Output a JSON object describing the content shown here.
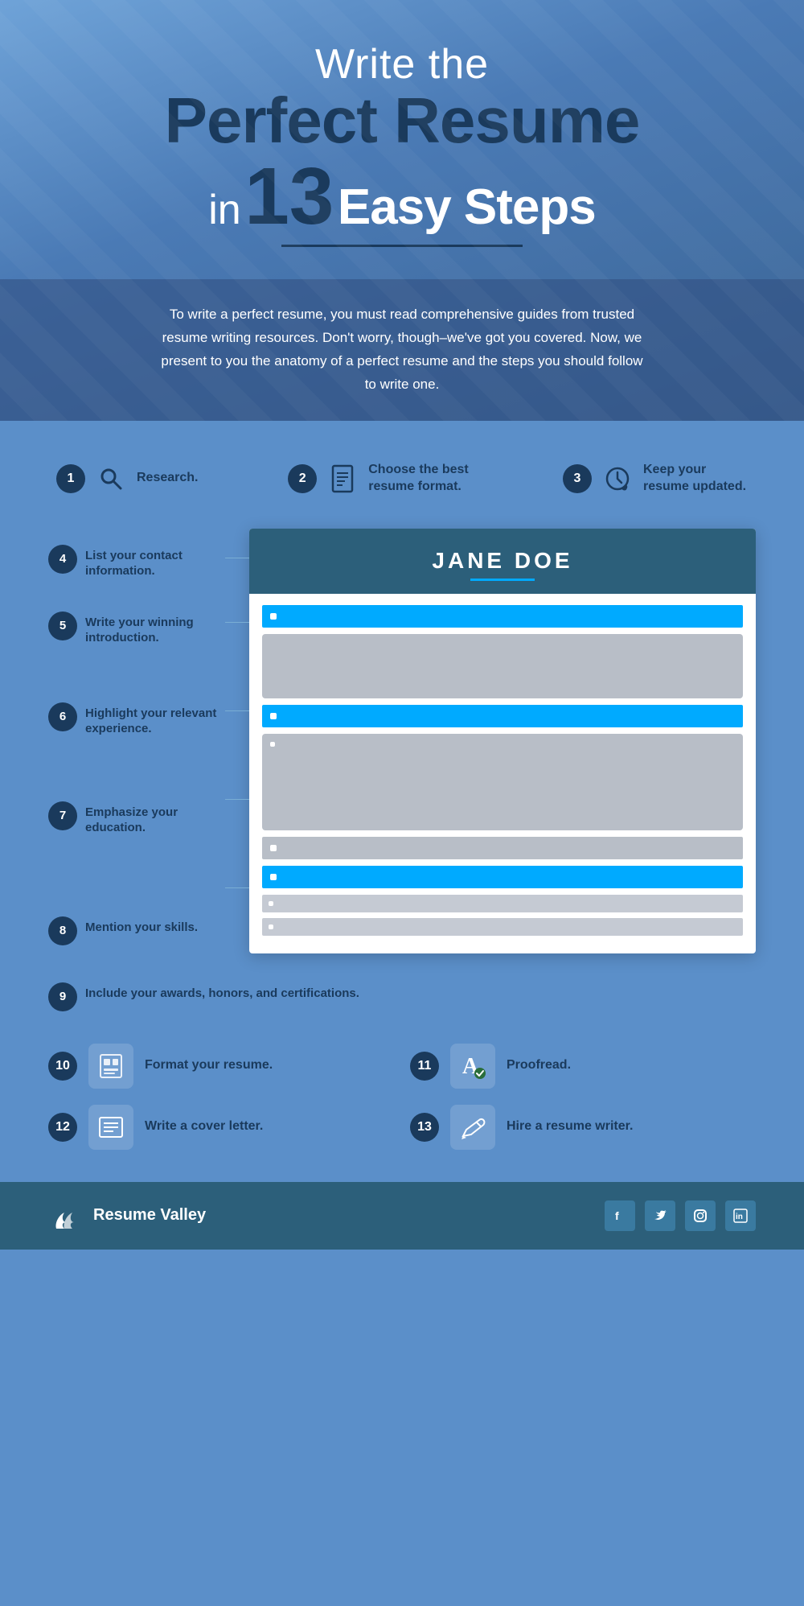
{
  "header": {
    "line1": "Write the",
    "line2": "Perfect Resume",
    "line3_in": "in",
    "line3_num": "13",
    "line3_rest": "Easy Steps",
    "subtitle": "To write a perfect resume, you must read comprehensive guides from trusted resume writing resources. Don't worry, though–we've got you covered. Now, we present to you the anatomy of a perfect resume and the steps you should follow to write one."
  },
  "steps": {
    "step1": {
      "number": "1",
      "label": "Research."
    },
    "step2": {
      "number": "2",
      "label": "Choose the best resume format."
    },
    "step3": {
      "number": "3",
      "label": "Keep your resume updated."
    },
    "step4": {
      "number": "4",
      "label": "List your contact information."
    },
    "step5": {
      "number": "5",
      "label": "Write your winning introduction."
    },
    "step6": {
      "number": "6",
      "label": "Highlight your relevant experience."
    },
    "step7": {
      "number": "7",
      "label": "Emphasize your education."
    },
    "step8": {
      "number": "8",
      "label": "Mention your skills."
    },
    "step9": {
      "number": "9",
      "label": "Include your awards, honors, and certifications."
    },
    "step10": {
      "number": "10",
      "label": "Format your resume."
    },
    "step11": {
      "number": "11",
      "label": "Proofread."
    },
    "step12": {
      "number": "12",
      "label": "Write a cover letter."
    },
    "step13": {
      "number": "13",
      "label": "Hire a resume writer."
    }
  },
  "resume": {
    "name": "JANE DOE"
  },
  "footer": {
    "brand": "Resume Valley",
    "social": [
      "f",
      "t",
      "cam",
      "in"
    ]
  }
}
